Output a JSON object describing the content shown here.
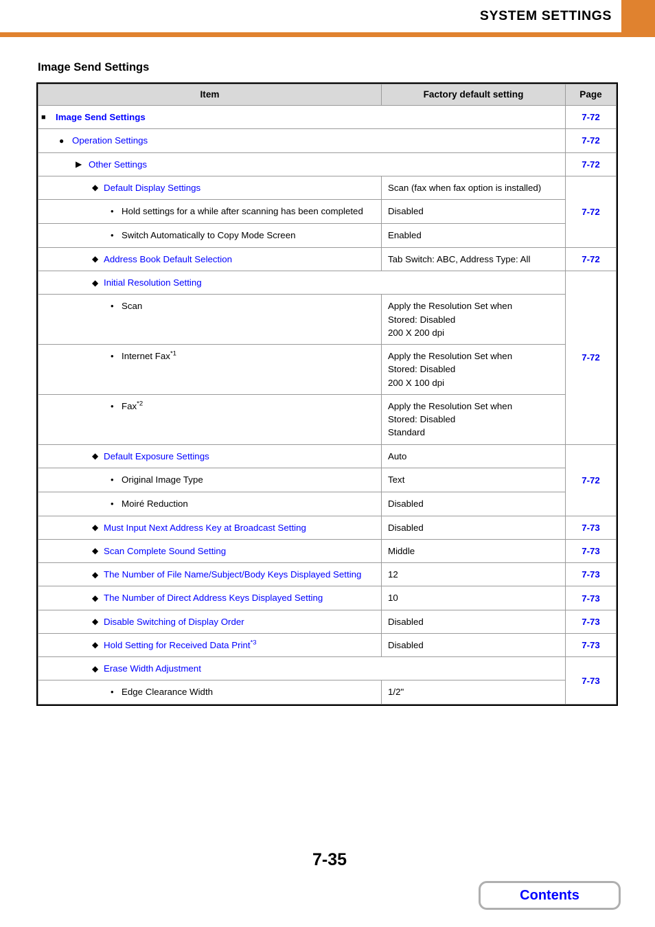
{
  "header": {
    "title": "SYSTEM SETTINGS",
    "accent_color": "#E0822F"
  },
  "section": {
    "title": "Image Send Settings"
  },
  "table": {
    "columns": [
      "Item",
      "Factory default setting",
      "Page"
    ],
    "rows": [
      {
        "marker": "■",
        "level": 1,
        "label": "Image Send Settings",
        "link": true,
        "factory": "",
        "span_item": true,
        "page": "7-72"
      },
      {
        "marker": "●",
        "level": 2,
        "label": "Operation Settings",
        "link": true,
        "factory": "",
        "span_item": true,
        "page": "7-72"
      },
      {
        "marker": "▶",
        "level": 3,
        "label": "Other Settings",
        "link": true,
        "factory": "",
        "span_item": true,
        "page": "7-72"
      },
      {
        "marker": "◆",
        "level": 4,
        "label": "Default Display Settings",
        "link": true,
        "factory": "Scan (fax when fax option is installed)",
        "page": "7-72",
        "page_rowspan": 3
      },
      {
        "marker": "•",
        "level": 5,
        "label": "Hold settings for a while after scanning has been completed",
        "link": false,
        "factory": "Disabled"
      },
      {
        "marker": "•",
        "level": 5,
        "label": "Switch Automatically to Copy Mode Screen",
        "link": false,
        "factory": "Enabled"
      },
      {
        "marker": "◆",
        "level": 4,
        "label": "Address Book Default Selection",
        "link": true,
        "factory": "Tab Switch: ABC, Address Type: All",
        "page": "7-72",
        "page_rowspan": 1
      },
      {
        "marker": "◆",
        "level": 4,
        "label": "Initial Resolution Setting",
        "link": true,
        "factory": "",
        "span_item": true,
        "page": "7-72",
        "page_rowspan": 4
      },
      {
        "marker": "•",
        "level": 5,
        "label": "Scan",
        "link": false,
        "factory": "Apply the Resolution Set when\nStored: Disabled\n200 X 200 dpi"
      },
      {
        "marker": "•",
        "level": 5,
        "label": "Internet Fax",
        "footnote": "*1",
        "link": false,
        "factory": "Apply the Resolution Set when\nStored: Disabled\n200 X 100 dpi"
      },
      {
        "marker": "•",
        "level": 5,
        "label": "Fax",
        "footnote": "*2",
        "link": false,
        "factory": "Apply the Resolution Set when\nStored: Disabled\nStandard"
      },
      {
        "marker": "◆",
        "level": 4,
        "label": "Default Exposure Settings",
        "link": true,
        "factory": "Auto",
        "page": "7-72",
        "page_rowspan": 3
      },
      {
        "marker": "•",
        "level": 5,
        "label": "Original Image Type",
        "link": false,
        "factory": "Text"
      },
      {
        "marker": "•",
        "level": 5,
        "label": "Moiré Reduction",
        "link": false,
        "factory": "Disabled"
      },
      {
        "marker": "◆",
        "level": 4,
        "label": "Must Input Next Address Key at Broadcast Setting",
        "link": true,
        "factory": "Disabled",
        "page": "7-73",
        "page_rowspan": 1
      },
      {
        "marker": "◆",
        "level": 4,
        "label": "Scan Complete Sound Setting",
        "link": true,
        "factory": "Middle",
        "page": "7-73",
        "page_rowspan": 1
      },
      {
        "marker": "◆",
        "level": 4,
        "label": "The Number of File Name/Subject/Body Keys Displayed Setting",
        "link": true,
        "factory": "12",
        "page": "7-73",
        "page_rowspan": 1
      },
      {
        "marker": "◆",
        "level": 4,
        "label": "The Number of Direct Address Keys Displayed Setting",
        "link": true,
        "factory": "10",
        "page": "7-73",
        "page_rowspan": 1
      },
      {
        "marker": "◆",
        "level": 4,
        "label": "Disable Switching of Display Order",
        "link": true,
        "factory": "Disabled",
        "page": "7-73",
        "page_rowspan": 1
      },
      {
        "marker": "◆",
        "level": 4,
        "label": "Hold Setting for Received Data Print",
        "footnote": "*3",
        "link": true,
        "factory": "Disabled",
        "page": "7-73",
        "page_rowspan": 1
      },
      {
        "marker": "◆",
        "level": 4,
        "label": "Erase Width Adjustment",
        "link": true,
        "factory": "",
        "span_item": true,
        "page": "7-73",
        "page_rowspan": 2
      },
      {
        "marker": "•",
        "level": 5,
        "label": "Edge Clearance Width",
        "link": false,
        "factory": "1/2\""
      }
    ]
  },
  "footer": {
    "page_number": "7-35",
    "contents_label": "Contents"
  }
}
